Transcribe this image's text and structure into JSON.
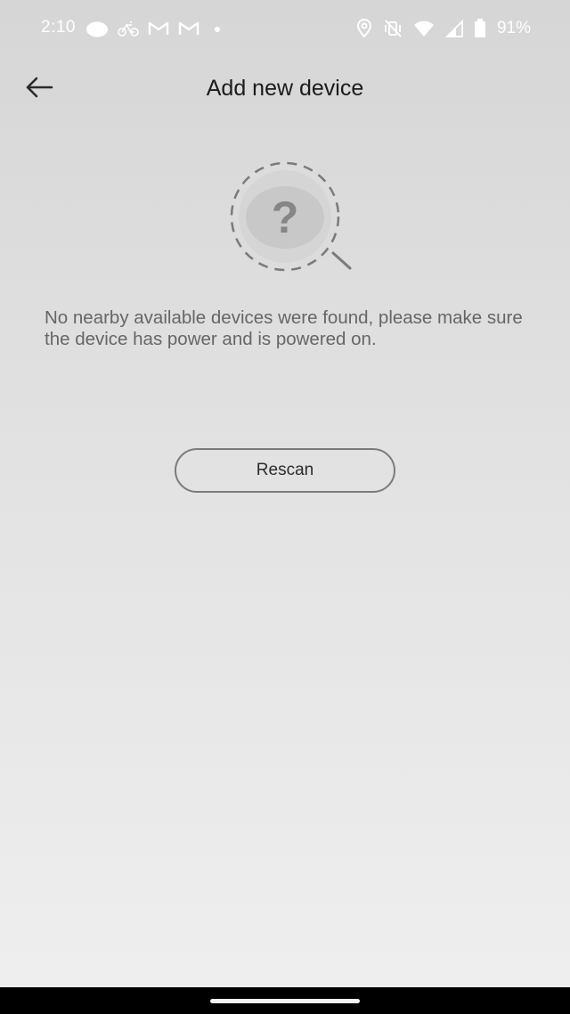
{
  "status_bar": {
    "time": "2:10",
    "battery_percent": "91%",
    "left_icons": [
      "cloud-icon",
      "bike-icon",
      "gmail-icon",
      "gmail-icon",
      "dot-icon"
    ],
    "right_icons": [
      "location-icon",
      "vibrate-off-icon",
      "wifi-icon",
      "signal-icon",
      "battery-icon"
    ]
  },
  "header": {
    "title": "Add new device",
    "back_icon": "arrow-left-icon"
  },
  "illustration": {
    "icon": "search-question-icon",
    "glyph": "?"
  },
  "message": {
    "text": "No nearby available devices were found, please make sure the device has power and is powered on."
  },
  "actions": {
    "rescan_label": "Rescan"
  },
  "colors": {
    "background_top": "#d6d6d6",
    "background_bottom": "#efefef",
    "message_text": "#666666",
    "button_border": "#7b7b7b",
    "illustration_fill": "#d0d0d0"
  }
}
